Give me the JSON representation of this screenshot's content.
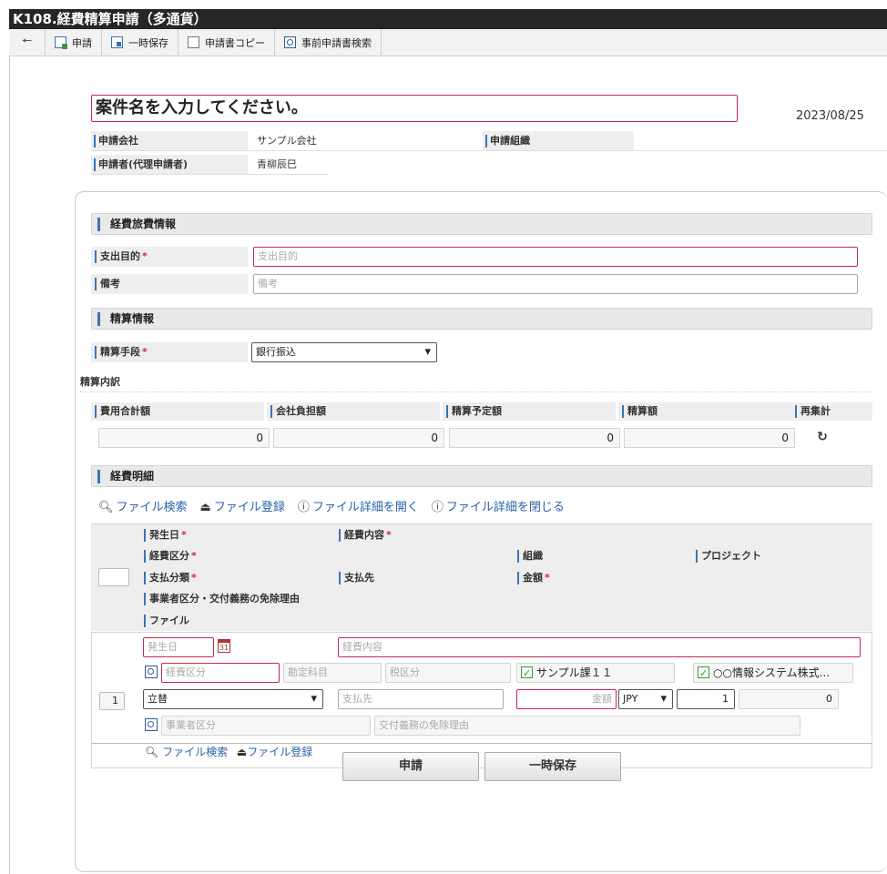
{
  "title": "K108.経費精算申請（多通貨）",
  "toolbar": {
    "back_icon": "back-arrow-icon",
    "apply": "申請",
    "temp_save": "一時保存",
    "copy": "申請書コピー",
    "pre_search": "事前申請書検索"
  },
  "header": {
    "subject": "案件名を入力してください。",
    "date": "2023/08/25",
    "company_label": "申請会社",
    "company_value": "サンプル会社",
    "org_label": "申請組織",
    "org_value": "",
    "applicant_label": "申請者(代理申請者)",
    "applicant_value": "青柳辰巳"
  },
  "travel": {
    "section": "経費旅費情報",
    "purpose_label": "支出目的",
    "purpose_placeholder": "支出目的",
    "note_label": "備考",
    "note_placeholder": "備考",
    "required_mark": "*"
  },
  "settlement": {
    "section": "精算情報",
    "method_label": "精算手段",
    "method_value": "銀行振込",
    "breakdown_title": "精算内訳",
    "cols": [
      "費用合計額",
      "会社負担額",
      "精算予定額",
      "精算額",
      "再集計"
    ],
    "values": [
      "0",
      "0",
      "0",
      "0"
    ],
    "refresh_icon": "refresh-icon"
  },
  "details": {
    "section": "経費明細",
    "links": [
      "ファイル検索",
      "ファイル登録",
      "ファイル詳細を開く",
      "ファイル詳細を閉じる"
    ],
    "head": {
      "date": "発生日",
      "content": "経費内容",
      "category": "経費区分",
      "org": "組織",
      "project": "プロジェクト",
      "paytype": "支払分類",
      "payee": "支払先",
      "amount": "金額",
      "biz": "事業者区分・交付義務の免除理由",
      "file": "ファイル"
    },
    "row": {
      "number": "1",
      "date_placeholder": "発生日",
      "content_placeholder": "経費内容",
      "category_placeholder": "経費区分",
      "account_placeholder": "勘定科目",
      "tax_placeholder": "税区分",
      "org_value": "サンプル課１１",
      "project_value": "○○情報システム株式...",
      "paytype_value": "立替",
      "payee_placeholder": "支払先",
      "amount_placeholder": "金額",
      "currency": "JPY",
      "rate": "1",
      "converted": "0",
      "biz_placeholder": "事業者区分",
      "exempt_placeholder": "交付義務の免除理由",
      "links": [
        "ファイル検索",
        "ファイル登録"
      ],
      "calendar_icon": "calendar-icon",
      "calendar_day": "31"
    }
  },
  "footer": {
    "apply": "申請",
    "temp_save": "一時保存"
  }
}
